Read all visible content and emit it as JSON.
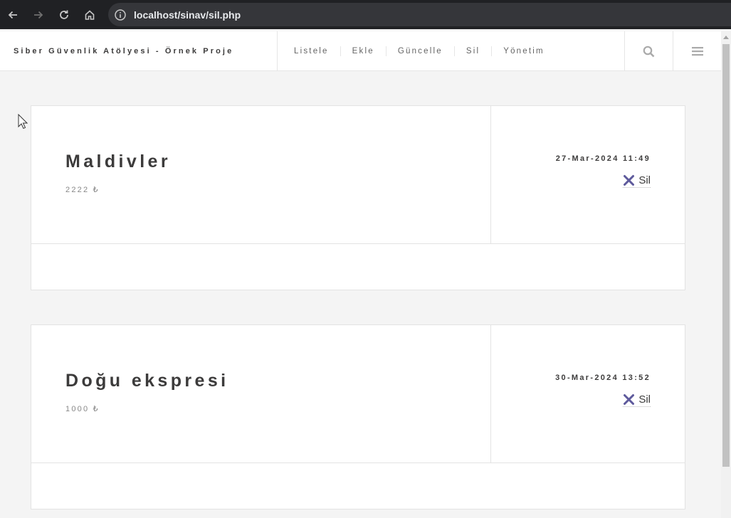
{
  "browser": {
    "url": "localhost/sinav/sil.php"
  },
  "header": {
    "site_title": "Siber Güvenlik Atölyesi - Örnek Proje",
    "nav": [
      "Listele",
      "Ekle",
      "Güncelle",
      "Sil",
      "Yönetim"
    ]
  },
  "posts": [
    {
      "title": "Maldivler",
      "price": "2222 ₺",
      "date": "27-Mar-2024 11:49",
      "delete_label": "Sil"
    },
    {
      "title": "Doğu ekspresi",
      "price": "1000 ₺",
      "date": "30-Mar-2024 13:52",
      "delete_label": "Sil"
    }
  ],
  "colors": {
    "accent": "#5e5a9c",
    "chrome": "#202124"
  }
}
